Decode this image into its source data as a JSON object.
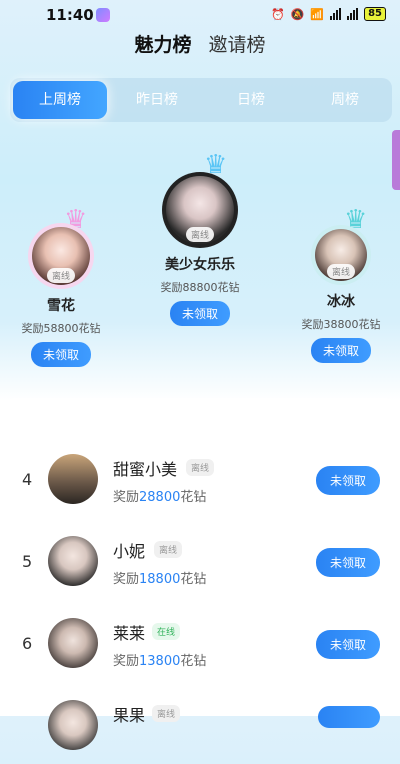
{
  "status_bar": {
    "time": "11:40",
    "battery": "85"
  },
  "top_nav": {
    "active": "魅力榜",
    "inactive": "邀请榜"
  },
  "period_tabs": [
    "上周榜",
    "昨日榜",
    "日榜",
    "周榜"
  ],
  "status_labels": {
    "offline": "离线",
    "online": "在线"
  },
  "podium": {
    "first": {
      "name": "美少女乐乐",
      "reward": "奖励88800花钻",
      "button": "未领取",
      "status": "离线"
    },
    "second": {
      "name": "雪花",
      "reward": "奖励58800花钻",
      "button": "未领取",
      "status": "离线"
    },
    "third": {
      "name": "冰冰",
      "reward": "奖励38800花钻",
      "button": "未领取",
      "status": "离线"
    }
  },
  "list": [
    {
      "rank": "4",
      "name": "甜蜜小美",
      "status": "离线",
      "reward_prefix": "奖励",
      "reward_amount": "28800",
      "reward_suffix": "花钻",
      "button": "未领取"
    },
    {
      "rank": "5",
      "name": "小妮",
      "status": "离线",
      "reward_prefix": "奖励",
      "reward_amount": "18800",
      "reward_suffix": "花钻",
      "button": "未领取"
    },
    {
      "rank": "6",
      "name": "莱莱",
      "status": "在线",
      "reward_prefix": "奖励",
      "reward_amount": "13800",
      "reward_suffix": "花钻",
      "button": "未领取"
    },
    {
      "rank": "",
      "name": "果果",
      "status": "离线",
      "reward_prefix": "",
      "reward_amount": "",
      "reward_suffix": "",
      "button": ""
    }
  ],
  "colors": {
    "accent": "#2a83f3",
    "online": "#31b25b"
  }
}
